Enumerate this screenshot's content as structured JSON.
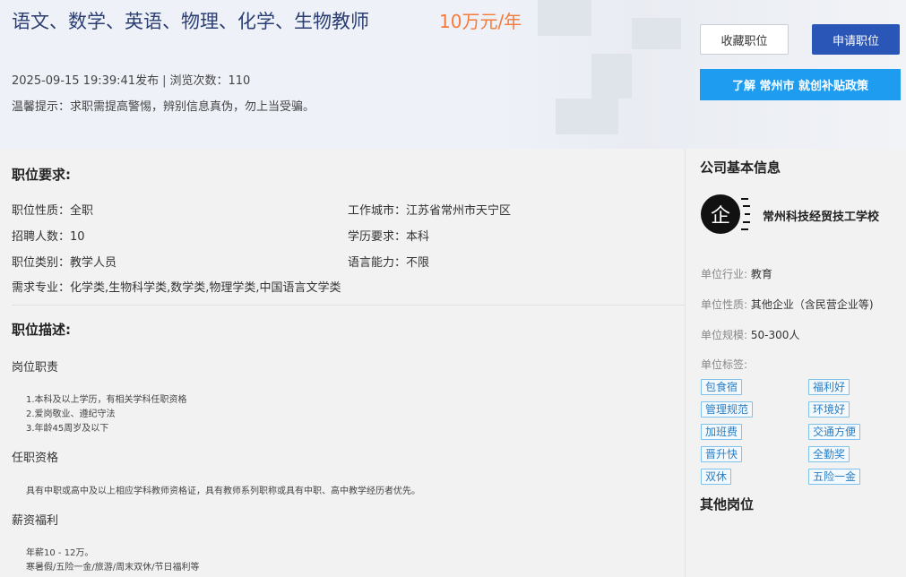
{
  "job": {
    "title": "语文、数学、英语、物理、化学、生物教师",
    "salary": "10万元/年",
    "published": "2025-09-15 19:39:41发布",
    "views_label": "浏览次数：",
    "views": "110",
    "warning": "温馨提示：求职需提高警惕，辨别信息真伪，勿上当受骗。"
  },
  "actions": {
    "favorite": "收藏职位",
    "apply": "申请职位",
    "policy": "了解 常州市 就创补贴政策"
  },
  "requirements": {
    "title": "职位要求:",
    "fields": [
      {
        "label": "职位性质：",
        "value": "全职"
      },
      {
        "label": "工作城市：",
        "value": "江苏省常州市天宁区"
      },
      {
        "label": "招聘人数：",
        "value": "10"
      },
      {
        "label": "学历要求：",
        "value": "本科"
      },
      {
        "label": "职位类别：",
        "value": "教学人员"
      },
      {
        "label": "语言能力：",
        "value": "不限"
      },
      {
        "label": "需求专业：",
        "value": "化学类,生物科学类,数学类,物理学类,中国语言文学类"
      }
    ]
  },
  "description": {
    "title": "职位描述:",
    "duty_title": "岗位职责",
    "duties": [
      "1.本科及以上学历，有相关学科任职资格",
      "2.爱岗敬业、遵纪守法",
      "3.年龄45周岁及以下"
    ],
    "qual_title": "任职资格",
    "qualification": "具有中职或高中及以上相应学科教师资格证，具有教师系列职称或具有中职、高中教学经历者优先。",
    "benefit_title": "薪资福利",
    "benefits": [
      "年薪10 - 12万。",
      "寒暑假/五险一金/旅游/周末双休/节日福利等"
    ]
  },
  "company": {
    "title": "公司基本信息",
    "logo_char": "企",
    "name": "常州科技经贸技工学校",
    "industry_label": "单位行业:",
    "industry": "教育",
    "nature_label": "单位性质:",
    "nature": "其他企业（含民营企业等)",
    "scale_label": "单位规模:",
    "scale": "50-300人",
    "tags_label": "单位标签:",
    "tags": [
      "包食宿",
      "福利好",
      "管理规范",
      "环境好",
      "加班费",
      "交通方便",
      "晋升快",
      "全勤奖",
      "双休",
      "五险一金"
    ]
  },
  "other": {
    "title": "其他岗位"
  }
}
